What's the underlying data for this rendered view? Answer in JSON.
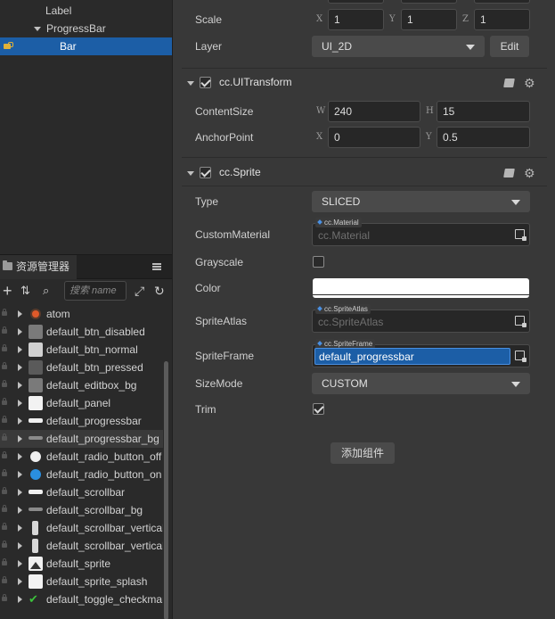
{
  "hierarchy": {
    "nodes": [
      {
        "label": "Label"
      },
      {
        "label": "ProgressBar"
      },
      {
        "label": "Bar"
      }
    ]
  },
  "assets": {
    "tab_label": "资源管理器",
    "search_placeholder": "搜索 name",
    "partial_top_label": "atom",
    "items": [
      {
        "label": "atom",
        "thumb": "atom-icon"
      },
      {
        "label": "default_btn_disabled",
        "thumb": "gray-square"
      },
      {
        "label": "default_btn_normal",
        "thumb": "light-square"
      },
      {
        "label": "default_btn_pressed",
        "thumb": "dark-square"
      },
      {
        "label": "default_editbox_bg",
        "thumb": "gray-square"
      },
      {
        "label": "default_panel",
        "thumb": "white-square"
      },
      {
        "label": "default_progressbar",
        "thumb": "white-bar"
      },
      {
        "label": "default_progressbar_bg",
        "thumb": "gray-bar"
      },
      {
        "label": "default_radio_button_off",
        "thumb": "white-circle"
      },
      {
        "label": "default_radio_button_on",
        "thumb": "blue-circle"
      },
      {
        "label": "default_scrollbar",
        "thumb": "white-bar"
      },
      {
        "label": "default_scrollbar_bg",
        "thumb": "gray-bar"
      },
      {
        "label": "default_scrollbar_vertical",
        "thumb": "vertical-bar"
      },
      {
        "label": "default_scrollbar_vertical_bg",
        "thumb": "vertical-bar"
      },
      {
        "label": "default_sprite",
        "thumb": "image-icon"
      },
      {
        "label": "default_sprite_splash",
        "thumb": "white-square"
      },
      {
        "label": "default_toggle_checkmark",
        "thumb": "checkmark"
      }
    ]
  },
  "inspector": {
    "scale": {
      "label": "Scale",
      "x_axis": "X",
      "x": "1",
      "y_axis": "Y",
      "y": "1",
      "z_axis": "Z",
      "z": "1"
    },
    "layer": {
      "label": "Layer",
      "value": "UI_2D",
      "edit_label": "Edit"
    },
    "ui_transform": {
      "title": "cc.UITransform",
      "content_size": {
        "label": "ContentSize",
        "w_axis": "W",
        "w": "240",
        "h_axis": "H",
        "h": "15"
      },
      "anchor_point": {
        "label": "AnchorPoint",
        "x_axis": "X",
        "x": "0",
        "y_axis": "Y",
        "y": "0.5"
      }
    },
    "sprite": {
      "title": "cc.Sprite",
      "type": {
        "label": "Type",
        "value": "SLICED"
      },
      "custom_material": {
        "label": "CustomMaterial",
        "tag": "cc.Material",
        "value": "cc.Material"
      },
      "grayscale": {
        "label": "Grayscale",
        "checked": false
      },
      "color": {
        "label": "Color",
        "value": "#ffffff"
      },
      "sprite_atlas": {
        "label": "SpriteAtlas",
        "tag": "cc.SpriteAtlas",
        "value": "cc.SpriteAtlas"
      },
      "sprite_frame": {
        "label": "SpriteFrame",
        "tag": "cc.SpriteFrame",
        "value": "default_progressbar"
      },
      "size_mode": {
        "label": "SizeMode",
        "value": "CUSTOM"
      },
      "trim": {
        "label": "Trim",
        "checked": true
      }
    },
    "add_component_label": "添加组件"
  },
  "colors": {
    "selection": "#1c5ea6",
    "accent_blue": "#4a90e2",
    "panel_bg": "#383838"
  }
}
